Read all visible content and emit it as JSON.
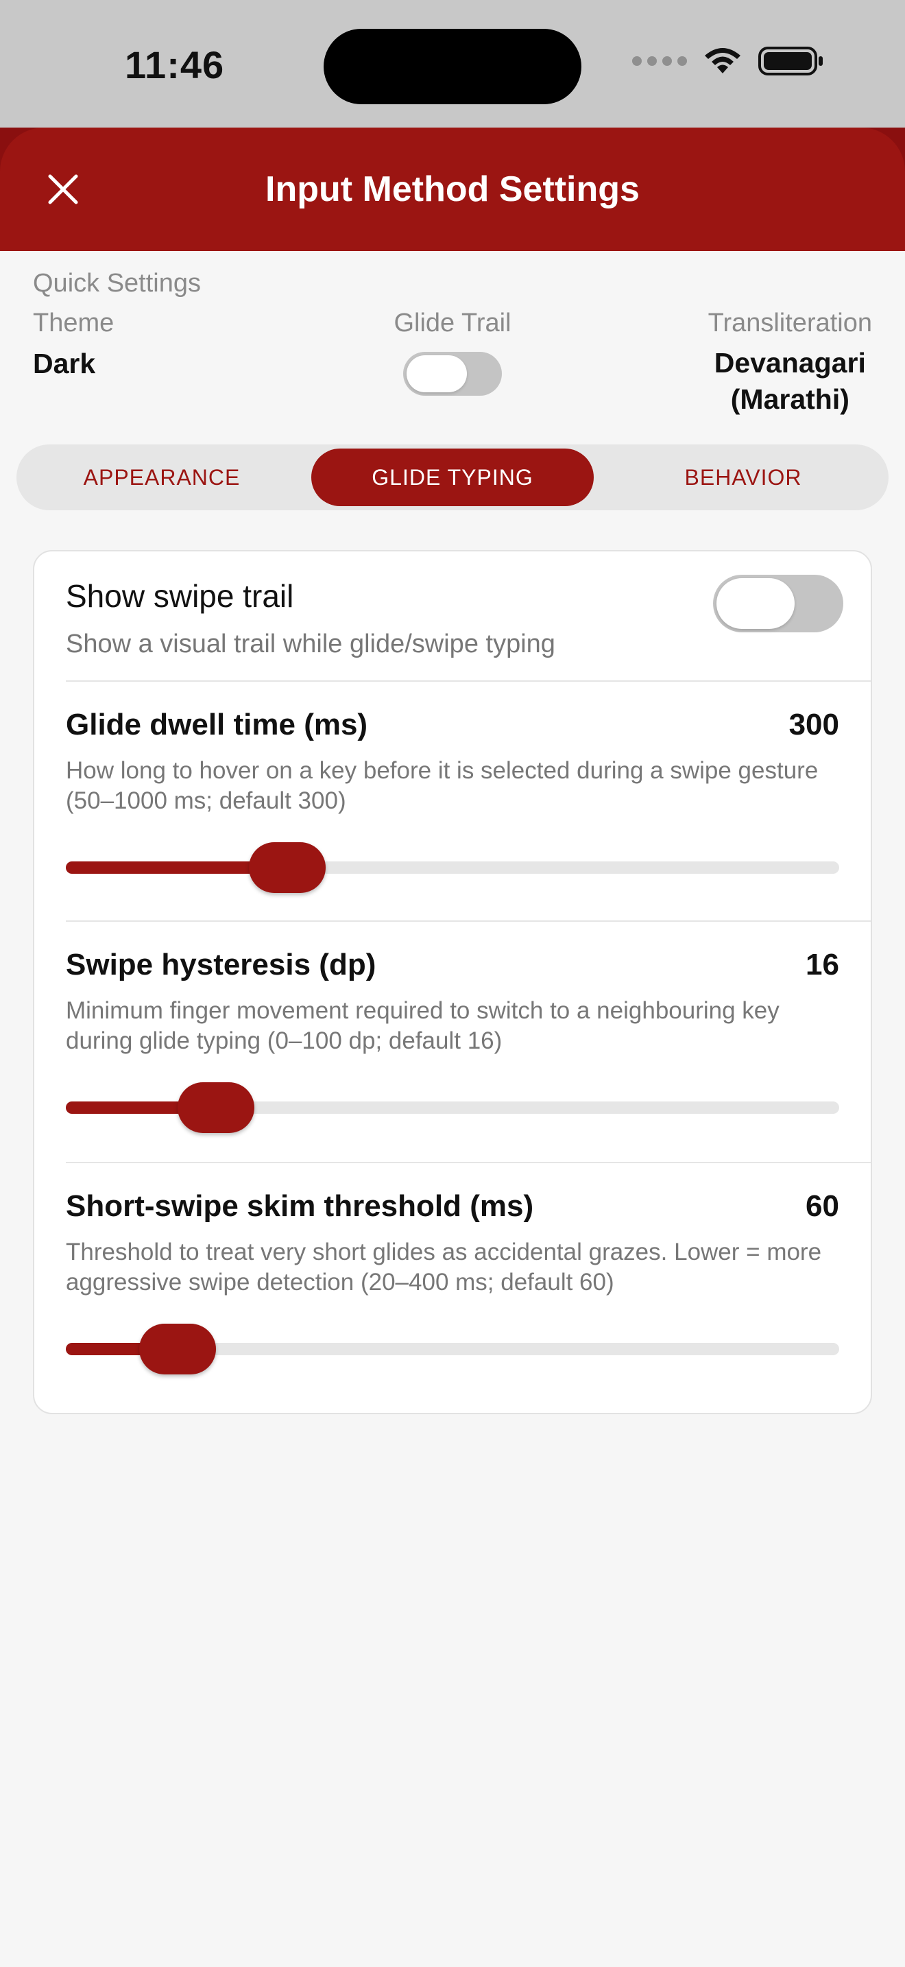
{
  "status": {
    "time": "11:46"
  },
  "header": {
    "title": "Input Method Settings"
  },
  "quick_settings": {
    "title": "Quick Settings",
    "theme": {
      "label": "Theme",
      "value": "Dark"
    },
    "glide_trail": {
      "label": "Glide Trail",
      "enabled": false
    },
    "transliteration": {
      "label": "Transliteration",
      "value_line1": "Devanagari",
      "value_line2": "(Marathi)"
    }
  },
  "tabs": [
    {
      "label": "APPEARANCE",
      "active": false
    },
    {
      "label": "GLIDE TYPING",
      "active": true
    },
    {
      "label": "BEHAVIOR",
      "active": false
    }
  ],
  "glide": {
    "show_trail": {
      "title": "Show swipe trail",
      "desc": "Show a visual trail while glide/swipe typing",
      "enabled": false
    },
    "dwell": {
      "title": "Glide dwell time (ms)",
      "value": "300",
      "desc": "How long to hover on a key before it is selected during a swipe gesture (50–1000 ms; default 300)",
      "min": 50,
      "max": 1000,
      "current": 300
    },
    "hysteresis": {
      "title": "Swipe hysteresis (dp)",
      "value": "16",
      "desc": "Minimum finger movement required to switch to a neighbouring key during glide typing (0–100 dp; default 16)",
      "min": 0,
      "max": 100,
      "current": 16
    },
    "skim": {
      "title": "Short-swipe skim threshold (ms)",
      "value": "60",
      "desc": "Threshold to treat very short glides as accidental grazes. Lower = more aggressive swipe detection (20–400 ms; default 60)",
      "min": 20,
      "max": 400,
      "current": 60
    }
  },
  "colors": {
    "accent": "#9b1512",
    "track": "#e6e6e6",
    "toggle_off": "#c4c4c4"
  }
}
